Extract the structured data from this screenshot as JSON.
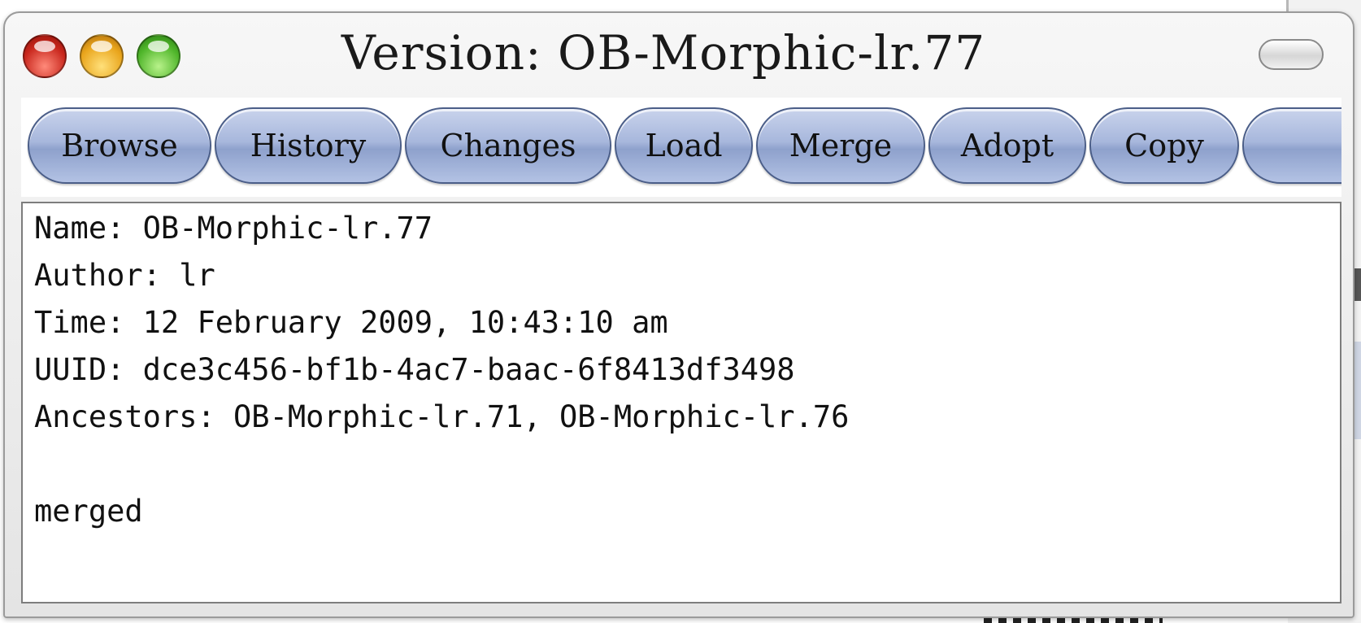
{
  "window": {
    "title": "Version: OB-Morphic-lr.77"
  },
  "toolbar": {
    "buttons": [
      {
        "label": "Browse"
      },
      {
        "label": "History"
      },
      {
        "label": "Changes"
      },
      {
        "label": "Load"
      },
      {
        "label": "Merge"
      },
      {
        "label": "Adopt"
      },
      {
        "label": "Copy"
      },
      {
        "label": ""
      }
    ]
  },
  "info": {
    "name": "Name: OB-Morphic-lr.77",
    "author": "Author: lr",
    "time": "Time: 12 February 2009, 10:43:10 am",
    "uuid": "UUID: dce3c456-bf1b-4ac7-baac-6f8413df3498",
    "ancestors": "Ancestors: OB-Morphic-lr.71, OB-Morphic-lr.76",
    "message": "merged"
  },
  "colors": {
    "button_fill": "#a7b7dc",
    "button_border": "#4b5e88",
    "close": "#c8261c",
    "minimize": "#e9a51c",
    "zoom": "#4fb52a"
  },
  "icons": [
    "close-icon",
    "minimize-icon",
    "zoom-icon",
    "collapse-icon"
  ]
}
